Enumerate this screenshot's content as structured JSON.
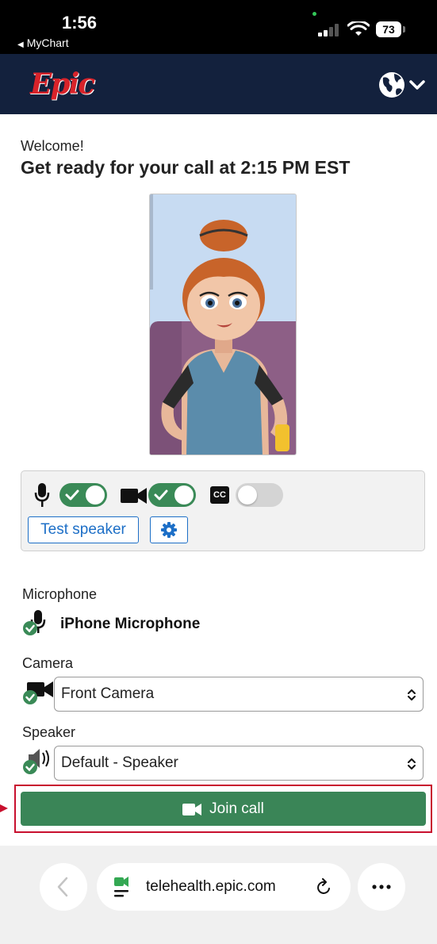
{
  "status_bar": {
    "time": "1:56",
    "back_label": "MyChart",
    "battery": "73"
  },
  "header": {
    "logo": "Epic",
    "language_icon": "globe-icon"
  },
  "welcome": {
    "greeting": "Welcome!",
    "title": "Get ready for your call at 2:15 PM EST"
  },
  "controls": {
    "microphone_toggle": true,
    "camera_toggle": true,
    "captions_toggle": false,
    "captions_label": "CC",
    "test_speaker_label": "Test speaker",
    "settings_icon": "gear-icon"
  },
  "devices": {
    "microphone_label": "Microphone",
    "microphone_value": "iPhone Microphone",
    "camera_label": "Camera",
    "camera_value": "Front Camera",
    "speaker_label": "Speaker",
    "speaker_value": "Default - Speaker"
  },
  "join": {
    "label": "Join call"
  },
  "browser": {
    "url": "telehealth.epic.com"
  },
  "colors": {
    "header_bg": "#13213d",
    "brand_red": "#d8232a",
    "toggle_on": "#3a8a57",
    "join_green": "#3a8557",
    "link_blue": "#1d6fc7",
    "highlight_red": "#c8102e"
  }
}
